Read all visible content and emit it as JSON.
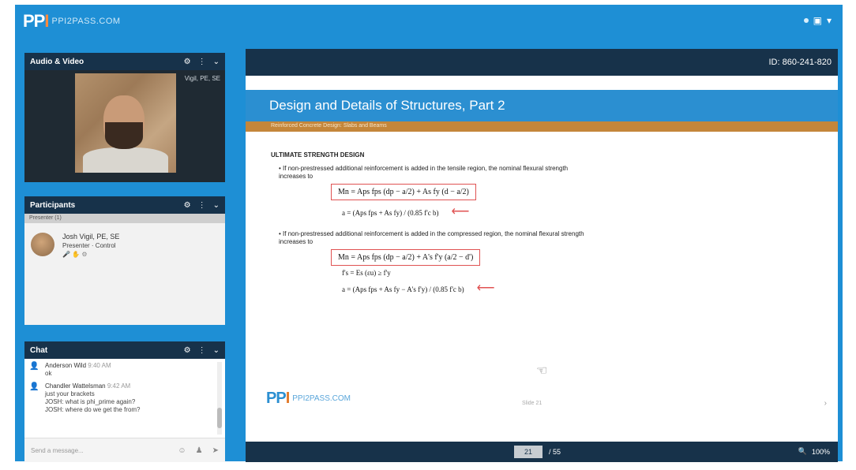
{
  "app": {
    "logo_mark_left": "PP",
    "logo_mark_i": "I",
    "logo_site": "PPI2PASS.COM"
  },
  "video_panel": {
    "title": "Audio & Video",
    "presenter_label": "Vigil, PE, SE"
  },
  "participants_panel": {
    "title": "Participants",
    "sub_header": "Presenter (1)",
    "participant": {
      "name": "Josh Vigil, PE, SE",
      "role": "Presenter · Control",
      "icons": "🎤 ✋ ⚙"
    }
  },
  "chat_panel": {
    "title": "Chat",
    "messages": [
      {
        "name": "Anderson Wild",
        "time": "9:40 AM",
        "lines": [
          "ok"
        ]
      },
      {
        "name": "Chandler Wattelsman",
        "time": "9:42 AM",
        "lines": [
          "just your brackets",
          "JOSH: what is phi_prime again?",
          "JOSH: where do we get the from?"
        ]
      }
    ],
    "input_placeholder": "Send a message..."
  },
  "main": {
    "meeting_id": "ID: 860-241-820",
    "slide": {
      "title": "Design and Details of Structures, Part 2",
      "subtitle": "Reinforced Concrete Design: Slabs and Beams",
      "heading": "ULTIMATE STRENGTH DESIGN",
      "bullet1": "If non-prestressed additional reinforcement is added in the tensile region, the nominal flexural strength increases to",
      "eq1": "Mn = Aps fps (dp − a/2) + As fy (d − a/2)",
      "eq1b": "a = (Aps fps + As fy) / (0.85 f'c b)",
      "bullet2": "If non-prestressed additional reinforcement is added in the compressed region, the nominal flexural strength increases to",
      "eq2": "Mn = Aps fps (dp − a/2) + A's f'y (a/2 − d')",
      "eq2b": "f's = Es (εu) ≥ f'y",
      "eq2c": "a = (Aps fps + As fy − A's f'y) / (0.85 f'c b)",
      "page_label": "Slide 21",
      "next_arrow": "›",
      "footer_site": "PPI2PASS.COM"
    },
    "controls": {
      "page_current": "21",
      "page_total": "/ 55",
      "zoom_label": "100%"
    }
  }
}
